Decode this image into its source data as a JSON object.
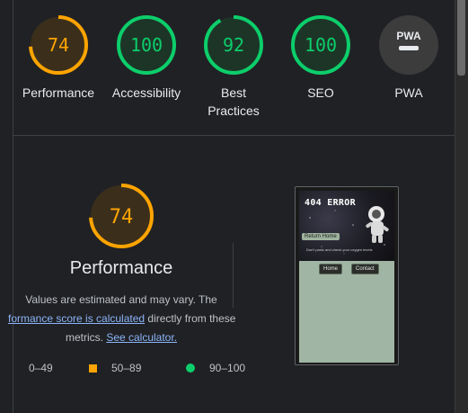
{
  "scores": [
    {
      "value": "74",
      "label": "Performance",
      "label2": "",
      "status": "average"
    },
    {
      "value": "100",
      "label": "Accessibility",
      "label2": "",
      "status": "pass"
    },
    {
      "value": "92",
      "label": "Best",
      "label2": "Practices",
      "status": "pass"
    },
    {
      "value": "100",
      "label": "SEO",
      "label2": "",
      "status": "pass"
    },
    {
      "value": "PWA",
      "label": "PWA",
      "label2": "",
      "status": "pwa"
    }
  ],
  "performance": {
    "score": "74",
    "title": "Performance",
    "desc_line1": "Values are estimated and may vary. The",
    "calc_link": "formance score is calculated",
    "desc_mid": " directly from these",
    "desc_line3_prefix": "metrics. ",
    "see_calc_link": "See calculator."
  },
  "legend": {
    "fail": "0–49",
    "average": "50–89",
    "pass": "90–100"
  },
  "screenshot": {
    "title": "404 ERROR",
    "return_label": "Return Home",
    "note": "Don't panic and check your oxygen levels",
    "home_label": "Home",
    "contact_label": "Contact"
  },
  "colors": {
    "average": "#ffa400",
    "average_bg": "#3b2f1c",
    "pass": "#0cce6b",
    "pass_bg": "#1d3527",
    "fail": "#ff4e42",
    "pwa_bg": "#3c3c3c"
  }
}
